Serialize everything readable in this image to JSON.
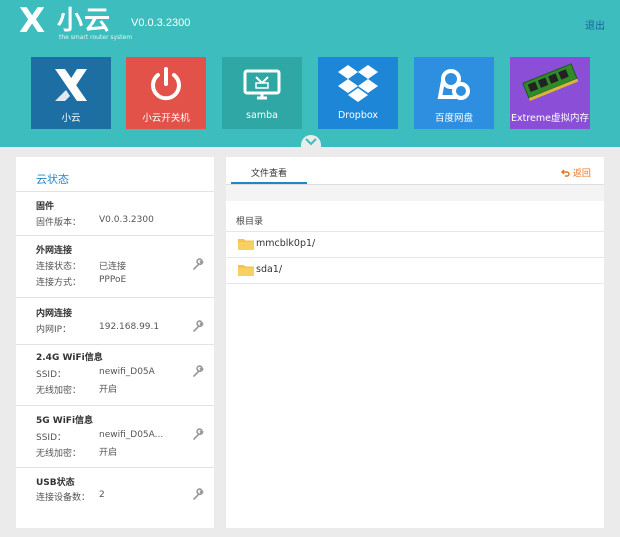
{
  "header": {
    "logo_text": "小云",
    "logo_tagline": "the smart router system",
    "version": "V0.0.3.2300",
    "logout_label": "退出"
  },
  "tiles": [
    {
      "label": "小云",
      "color": "#1d6fa3",
      "icon": "xiaoyun-x-icon"
    },
    {
      "label": "小云开关机",
      "color": "#e25249",
      "icon": "power-icon"
    },
    {
      "label": "samba",
      "color": "#2fa7a5",
      "icon": "monitor-icon"
    },
    {
      "label": "Dropbox",
      "color": "#1e86d6",
      "icon": "dropbox-icon"
    },
    {
      "label": "百度网盘",
      "color": "#2e8fe0",
      "icon": "baidu-cloud-icon"
    },
    {
      "label": "Extreme虚拟内存",
      "color": "#8a4fd6",
      "icon": "memory-stick-icon"
    }
  ],
  "status_panel": {
    "title": "云状态",
    "sections": [
      {
        "heading": "固件",
        "rows": [
          {
            "label": "固件版本：",
            "value": "V0.0.3.2300"
          }
        ],
        "editable": false
      },
      {
        "heading": "外网连接",
        "rows": [
          {
            "label": "连接状态：",
            "value": "已连接"
          },
          {
            "label": "连接方式：",
            "value": "PPPoE"
          }
        ],
        "editable": true
      },
      {
        "heading": "内网连接",
        "rows": [
          {
            "label": "内网IP：",
            "value": "192.168.99.1"
          }
        ],
        "editable": true
      },
      {
        "heading": "2.4G WiFi信息",
        "rows": [
          {
            "label": "SSID：",
            "value": "newifi_D05A"
          },
          {
            "label": "无线加密：",
            "value": "开启"
          }
        ],
        "editable": true
      },
      {
        "heading": "5G WiFi信息",
        "rows": [
          {
            "label": "SSID：",
            "value": "newifi_D05A..."
          },
          {
            "label": "无线加密：",
            "value": "开启"
          }
        ],
        "editable": true
      },
      {
        "heading": "USB状态",
        "rows": [
          {
            "label": "连接设备数：",
            "value": "2"
          }
        ],
        "editable": true
      }
    ]
  },
  "file_panel": {
    "tab_label": "文件查看",
    "back_label": "返回",
    "root_label": "根目录",
    "folders": [
      {
        "name": "mmcblk0p1/"
      },
      {
        "name": "sda1/"
      }
    ]
  },
  "colors": {
    "header_bg": "#3dbdbd",
    "accent_blue": "#1e88c7",
    "back_orange": "#e8731d",
    "folder_yellow": "#f4c54a"
  }
}
